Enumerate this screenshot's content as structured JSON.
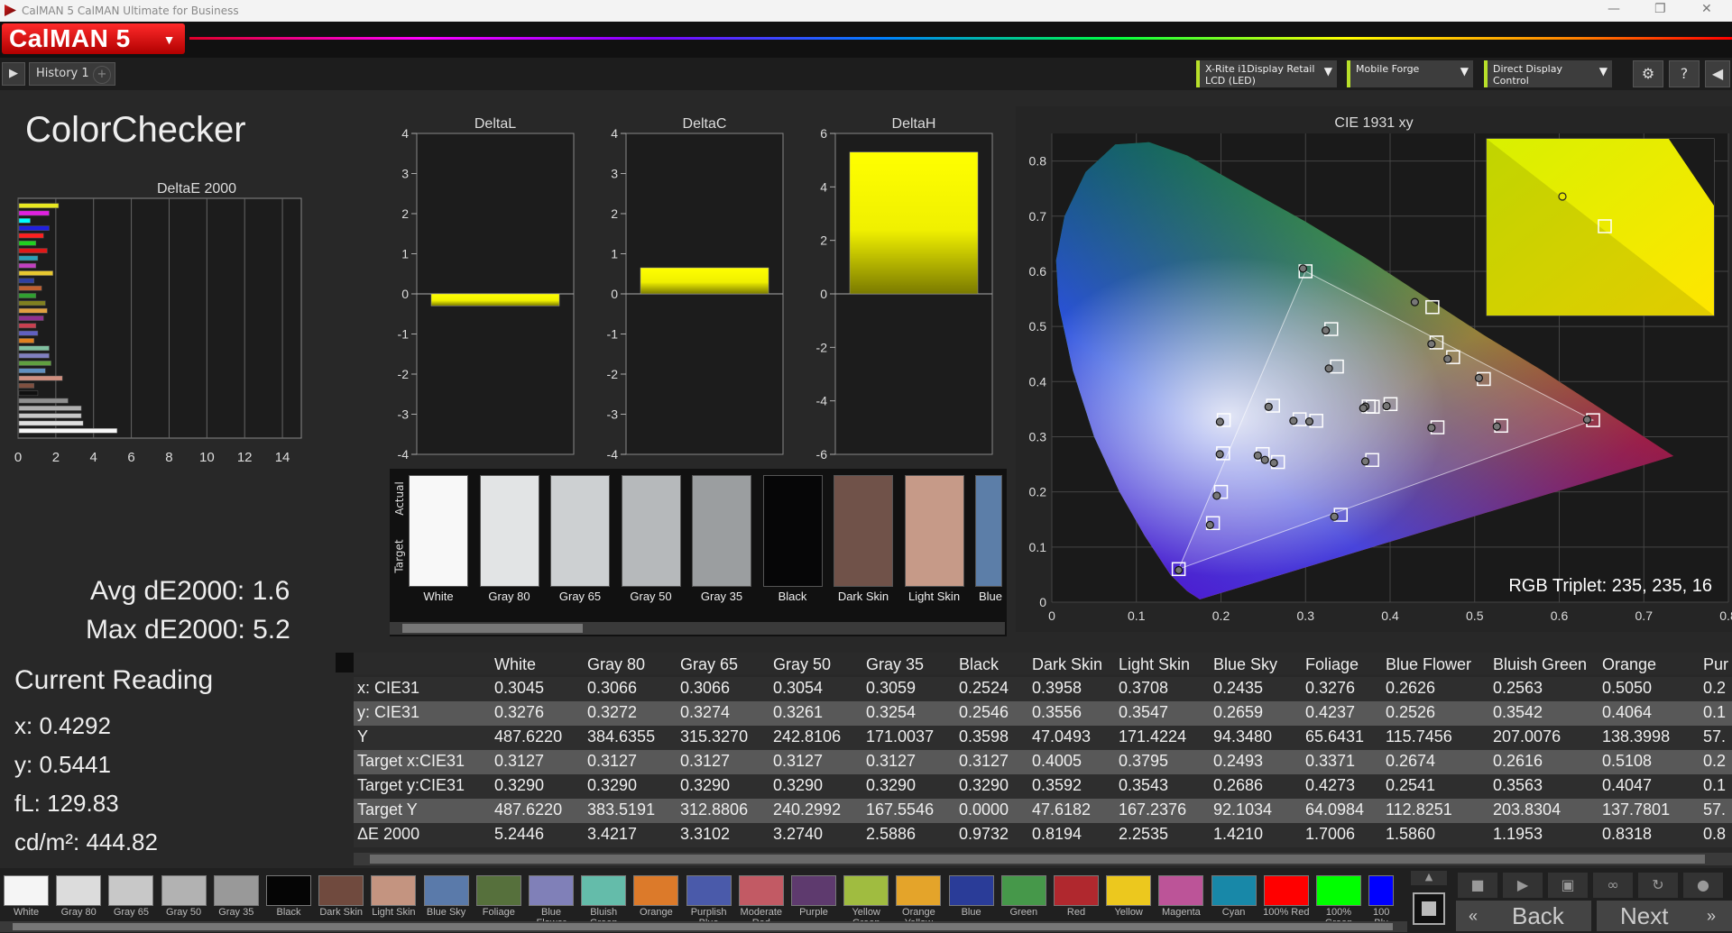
{
  "window": {
    "title": "CalMAN 5 CalMAN Ultimate for Business"
  },
  "app": {
    "logo": "CalMAN 5"
  },
  "toolbar": {
    "play_icon": "play-icon",
    "tab_label": "History 1",
    "add_tab": "+",
    "devices": [
      {
        "line1": "X-Rite i1Display Retail",
        "line2": "LCD (LED)"
      },
      {
        "line1": "Mobile Forge",
        "line2": ""
      },
      {
        "line1": "Direct Display Control",
        "line2": ""
      }
    ]
  },
  "page": {
    "title": "ColorChecker",
    "avg_label": "Avg dE2000: 1.6",
    "max_label": "Max dE2000: 5.2",
    "rgb_triplet": "RGB Triplet: 235, 235, 16"
  },
  "current_reading": {
    "title": "Current Reading",
    "x": "x: 0.4292",
    "y": "y: 0.5441",
    "fl": "fL: 129.83",
    "cdm2": "cd/m²: 444.82"
  },
  "chart_data": [
    {
      "type": "bar",
      "orientation": "horizontal",
      "title": "DeltaE 2000",
      "xlim": [
        0,
        15
      ],
      "xticks": [
        0,
        2,
        4,
        6,
        8,
        10,
        12,
        14
      ],
      "bars": [
        {
          "color": "#e8e820",
          "value": 2.1
        },
        {
          "color": "#e020e0",
          "value": 1.6
        },
        {
          "color": "#00ffff",
          "value": 0.6
        },
        {
          "color": "#2020e0",
          "value": 1.6
        },
        {
          "color": "#ff2020",
          "value": 1.3
        },
        {
          "color": "#20d020",
          "value": 0.9
        },
        {
          "color": "#e01818",
          "value": 1.5
        },
        {
          "color": "#2aa0b8",
          "value": 1.0
        },
        {
          "color": "#c040c0",
          "value": 0.9
        },
        {
          "color": "#e8c830",
          "value": 1.8
        },
        {
          "color": "#3040a0",
          "value": 0.8
        },
        {
          "color": "#c06030",
          "value": 1.2
        },
        {
          "color": "#30a030",
          "value": 0.9
        },
        {
          "color": "#808020",
          "value": 1.4
        },
        {
          "color": "#e0a040",
          "value": 1.5
        },
        {
          "color": "#903090",
          "value": 1.3
        },
        {
          "color": "#c84050",
          "value": 0.9
        },
        {
          "color": "#6060c0",
          "value": 1.0
        },
        {
          "color": "#e08020",
          "value": 0.8
        },
        {
          "color": "#80c0a0",
          "value": 1.6
        },
        {
          "color": "#8080c0",
          "value": 1.6
        },
        {
          "color": "#60a040",
          "value": 1.7
        },
        {
          "color": "#6090c0",
          "value": 1.4
        },
        {
          "color": "#d09080",
          "value": 2.3
        },
        {
          "color": "#805040",
          "value": 0.8
        },
        {
          "color": "#101010",
          "value": 1.0
        },
        {
          "color": "#909090",
          "value": 2.6
        },
        {
          "color": "#b0b0b0",
          "value": 3.3
        },
        {
          "color": "#c8c8c8",
          "value": 3.3
        },
        {
          "color": "#e0e0e0",
          "value": 3.4
        },
        {
          "color": "#f8f8f8",
          "value": 5.2
        }
      ]
    },
    {
      "type": "bar",
      "title": "DeltaL",
      "ylim": [
        -4,
        4
      ],
      "yticks": [
        4,
        3,
        2,
        1,
        0,
        -1,
        -2,
        -3,
        -4
      ],
      "values": [
        -0.3
      ]
    },
    {
      "type": "bar",
      "title": "DeltaC",
      "ylim": [
        -4,
        4
      ],
      "yticks": [
        4,
        3,
        2,
        1,
        0,
        -1,
        -2,
        -3,
        -4
      ],
      "values": [
        0.65
      ]
    },
    {
      "type": "bar",
      "title": "DeltaH",
      "ylim": [
        -6,
        6
      ],
      "yticks": [
        6,
        4,
        2,
        0,
        -2,
        -4,
        -6
      ],
      "values": [
        5.3
      ]
    },
    {
      "type": "scatter",
      "title": "CIE 1931 xy",
      "xlim": [
        0,
        0.8
      ],
      "ylim": [
        0,
        0.85
      ],
      "xticks": [
        0,
        0.1,
        0.2,
        0.3,
        0.4,
        0.5,
        0.6,
        0.7,
        0.8
      ],
      "yticks": [
        0,
        0.1,
        0.2,
        0.3,
        0.4,
        0.5,
        0.6,
        0.7,
        0.8
      ],
      "gamut_triangle": [
        [
          0.64,
          0.33
        ],
        [
          0.3,
          0.6
        ],
        [
          0.15,
          0.06
        ]
      ],
      "targets": [
        [
          0.64,
          0.33
        ],
        [
          0.3,
          0.6
        ],
        [
          0.15,
          0.06
        ],
        [
          0.3127,
          0.329
        ],
        [
          0.3795,
          0.3543
        ],
        [
          0.3371,
          0.4273
        ],
        [
          0.2493,
          0.2686
        ],
        [
          0.2674,
          0.2541
        ],
        [
          0.2616,
          0.3563
        ],
        [
          0.5108,
          0.4047
        ],
        [
          0.4005,
          0.3592
        ],
        [
          0.2,
          0.2
        ],
        [
          0.1905,
          0.1434
        ],
        [
          0.3304,
          0.4952
        ],
        [
          0.4549,
          0.4709
        ],
        [
          0.4745,
          0.4443
        ],
        [
          0.5313,
          0.3199
        ],
        [
          0.3788,
          0.2578
        ],
        [
          0.2033,
          0.3302
        ],
        [
          0.2025,
          0.2699
        ],
        [
          0.3746,
          0.3549
        ],
        [
          0.3416,
          0.1585
        ],
        [
          0.456,
          0.317
        ],
        [
          0.293,
          0.3316
        ],
        [
          0.45,
          0.535
        ]
      ],
      "measured": [
        [
          0.633,
          0.331
        ],
        [
          0.297,
          0.605
        ],
        [
          0.15,
          0.058
        ],
        [
          0.3045,
          0.3276
        ],
        [
          0.3708,
          0.3547
        ],
        [
          0.3276,
          0.4237
        ],
        [
          0.2435,
          0.2659
        ],
        [
          0.2626,
          0.2526
        ],
        [
          0.2563,
          0.3542
        ],
        [
          0.505,
          0.4064
        ],
        [
          0.3958,
          0.3556
        ],
        [
          0.195,
          0.193
        ],
        [
          0.187,
          0.14
        ],
        [
          0.3239,
          0.4927
        ],
        [
          0.4489,
          0.4681
        ],
        [
          0.468,
          0.441
        ],
        [
          0.5262,
          0.3185
        ],
        [
          0.3707,
          0.2553
        ],
        [
          0.1988,
          0.327
        ],
        [
          0.1986,
          0.2683
        ],
        [
          0.3683,
          0.3519
        ],
        [
          0.334,
          0.155
        ],
        [
          0.4489,
          0.3162
        ],
        [
          0.2857,
          0.3289
        ],
        [
          0.4292,
          0.5441
        ],
        [
          0.252,
          0.258
        ]
      ]
    }
  ],
  "deltaL": {
    "title": "DeltaL"
  },
  "deltaC": {
    "title": "DeltaC"
  },
  "deltaH": {
    "title": "DeltaH"
  },
  "deltaE": {
    "title": "DeltaE 2000"
  },
  "cie": {
    "title": "CIE 1931 xy"
  },
  "swatch_panel": {
    "actual_label": "Actual",
    "target_label": "Target",
    "swatches": [
      {
        "name": "White",
        "color": "#f8f8f8"
      },
      {
        "name": "Gray 80",
        "color": "#e2e4e5"
      },
      {
        "name": "Gray 65",
        "color": "#cdd0d2"
      },
      {
        "name": "Gray 50",
        "color": "#b6b9bb"
      },
      {
        "name": "Gray 35",
        "color": "#9b9ea0"
      },
      {
        "name": "Black",
        "color": "#060607"
      },
      {
        "name": "Dark Skin",
        "color": "#705249"
      },
      {
        "name": "Light Skin",
        "color": "#c69a88"
      },
      {
        "name": "Blue",
        "color": "#5c7ea8"
      }
    ]
  },
  "table": {
    "columns": [
      "White",
      "Gray 80",
      "Gray 65",
      "Gray 50",
      "Gray 35",
      "Black",
      "Dark Skin",
      "Light Skin",
      "Blue Sky",
      "Foliage",
      "Blue Flower",
      "Bluish Green",
      "Orange",
      "Pur"
    ],
    "rows": [
      {
        "label": "x: CIE31",
        "values": [
          "0.3045",
          "0.3066",
          "0.3066",
          "0.3054",
          "0.3059",
          "0.2524",
          "0.3958",
          "0.3708",
          "0.2435",
          "0.3276",
          "0.2626",
          "0.2563",
          "0.5050",
          "0.2"
        ]
      },
      {
        "label": "y: CIE31",
        "values": [
          "0.3276",
          "0.3272",
          "0.3274",
          "0.3261",
          "0.3254",
          "0.2546",
          "0.3556",
          "0.3547",
          "0.2659",
          "0.4237",
          "0.2526",
          "0.3542",
          "0.4064",
          "0.1"
        ]
      },
      {
        "label": "Y",
        "values": [
          "487.6220",
          "384.6355",
          "315.3270",
          "242.8106",
          "171.0037",
          "0.3598",
          "47.0493",
          "171.4224",
          "94.3480",
          "65.6431",
          "115.7456",
          "207.0076",
          "138.3998",
          "57."
        ]
      },
      {
        "label": "Target x:CIE31",
        "values": [
          "0.3127",
          "0.3127",
          "0.3127",
          "0.3127",
          "0.3127",
          "0.3127",
          "0.4005",
          "0.3795",
          "0.2493",
          "0.3371",
          "0.2674",
          "0.2616",
          "0.5108",
          "0.2"
        ]
      },
      {
        "label": "Target y:CIE31",
        "values": [
          "0.3290",
          "0.3290",
          "0.3290",
          "0.3290",
          "0.3290",
          "0.3290",
          "0.3592",
          "0.3543",
          "0.2686",
          "0.4273",
          "0.2541",
          "0.3563",
          "0.4047",
          "0.1"
        ]
      },
      {
        "label": "Target Y",
        "values": [
          "487.6220",
          "383.5191",
          "312.8806",
          "240.2992",
          "167.5546",
          "0.0000",
          "47.6182",
          "167.2376",
          "92.1034",
          "64.0984",
          "112.8251",
          "203.8304",
          "137.7801",
          "57."
        ]
      },
      {
        "label": "ΔE 2000",
        "values": [
          "5.2446",
          "3.4217",
          "3.3102",
          "3.2740",
          "2.5886",
          "0.9732",
          "0.8194",
          "2.2535",
          "1.4210",
          "1.7006",
          "1.5860",
          "1.1953",
          "0.8318",
          "0.8"
        ]
      }
    ]
  },
  "bottom_strip": {
    "items": [
      {
        "name": "White",
        "color": "#f5f5f5"
      },
      {
        "name": "Gray 80",
        "color": "#dcdcdc"
      },
      {
        "name": "Gray 65",
        "color": "#c8c8c8"
      },
      {
        "name": "Gray 50",
        "color": "#b2b2b2"
      },
      {
        "name": "Gray 35",
        "color": "#999999"
      },
      {
        "name": "Black",
        "color": "#050505"
      },
      {
        "name": "Dark Skin",
        "color": "#704a3e"
      },
      {
        "name": "Light Skin",
        "color": "#c49480"
      },
      {
        "name": "Blue Sky",
        "color": "#5a7aaa"
      },
      {
        "name": "Foliage",
        "color": "#56703c"
      },
      {
        "name": "Blue Flower",
        "color": "#8080b8"
      },
      {
        "name": "Bluish Green",
        "color": "#64bcaa"
      },
      {
        "name": "Orange",
        "color": "#dc7a2a"
      },
      {
        "name": "Purplish Blue",
        "color": "#4a5aaa"
      },
      {
        "name": "Moderate Red",
        "color": "#c25a64"
      },
      {
        "name": "Purple",
        "color": "#5e3a6e"
      },
      {
        "name": "Yellow Green",
        "color": "#a0bc40"
      },
      {
        "name": "Orange Yellow",
        "color": "#e4a42a"
      },
      {
        "name": "Blue",
        "color": "#2a3c98"
      },
      {
        "name": "Green",
        "color": "#46984a"
      },
      {
        "name": "Red",
        "color": "#b0282e"
      },
      {
        "name": "Yellow",
        "color": "#ecc81e"
      },
      {
        "name": "Magenta",
        "color": "#bc5498"
      },
      {
        "name": "Cyan",
        "color": "#1888a8"
      },
      {
        "name": "100% Red",
        "color": "#ff0000"
      },
      {
        "name": "100% Green",
        "color": "#00ff00"
      },
      {
        "name": "100 Blu",
        "color": "#0000ff"
      }
    ],
    "back_label": "Back",
    "next_label": "Next"
  }
}
